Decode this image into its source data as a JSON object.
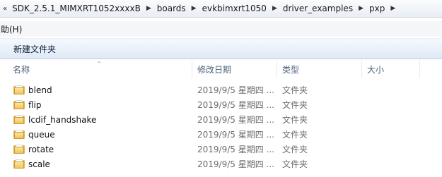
{
  "address_bar": {
    "arrow_glyph": "«",
    "crumbs": [
      {
        "label": "SDK_2.5.1_MIMXRT1052xxxxB"
      },
      {
        "label": "boards"
      },
      {
        "label": "evkbimxrt1050"
      },
      {
        "label": "driver_examples"
      },
      {
        "label": "pxp"
      }
    ],
    "separator_glyph": "▶"
  },
  "menu": {
    "items": [
      {
        "label": "帮助(H)"
      }
    ]
  },
  "toolbar": {
    "new_folder_label": "新建文件夹"
  },
  "columns": {
    "name": "名称",
    "date": "修改日期",
    "type": "类型",
    "size": "大小",
    "sort_glyph": "^"
  },
  "files": [
    {
      "name": "blend",
      "date": "2019/9/5 星期四 ...",
      "type": "文件夹",
      "icon": "folder-icon"
    },
    {
      "name": "flip",
      "date": "2019/9/5 星期四 ...",
      "type": "文件夹",
      "icon": "folder-icon"
    },
    {
      "name": "lcdif_handshake",
      "date": "2019/9/5 星期四 ...",
      "type": "文件夹",
      "icon": "folder-icon"
    },
    {
      "name": "queue",
      "date": "2019/9/5 星期四 ...",
      "type": "文件夹",
      "icon": "folder-icon"
    },
    {
      "name": "rotate",
      "date": "2019/9/5 星期四 ...",
      "type": "文件夹",
      "icon": "folder-icon"
    },
    {
      "name": "scale",
      "date": "2019/9/5 星期四 ...",
      "type": "文件夹",
      "icon": "folder-icon"
    }
  ],
  "colors": {
    "header_text": "#4c607a",
    "secondary_text": "#6d6d6d",
    "folder": "#f0c35e"
  }
}
